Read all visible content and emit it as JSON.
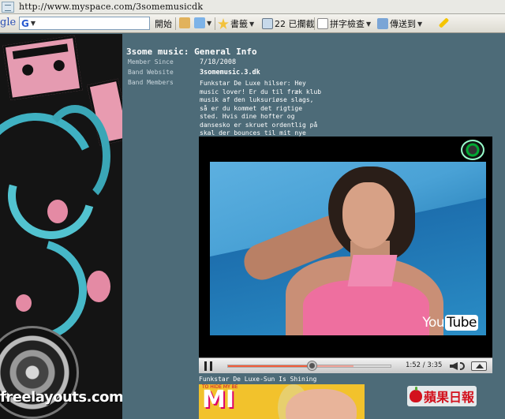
{
  "address_bar": {
    "url": "http://www.myspace.com/3somemusicdk"
  },
  "toolbar": {
    "brand": "gle",
    "search_glyph": "G",
    "open_label": "開始",
    "bookmarks_label": "書籤",
    "blocked_label": "22 已攔截",
    "spellcheck_label": "拼字檢查",
    "sendto_label": "傳送到",
    "colors": {
      "pencil": "#f5c400"
    }
  },
  "background": {
    "site_credit": "freelayouts.com"
  },
  "profile": {
    "title": "3some music: General Info",
    "fields": [
      {
        "label": "Member Since",
        "value": "7/18/2008"
      },
      {
        "label": "Band Website",
        "value": "3somemusic.3.dk"
      },
      {
        "label": "Band Members",
        "value": "Funkstar De Luxe hilser: Hey music lover! Er du til fræk klub musik af den luksuriøse slags, så er du kommet det rigtige sted. Hvis dine hofter og dansesko er skruet ordentlig på skal der bounces til mit nye track. Enjoy!"
      }
    ]
  },
  "player": {
    "brand": "YouTube",
    "brand_part1": "You",
    "brand_part2": "Tube",
    "elapsed": "1:52",
    "duration": "3:35",
    "time_display": "1:52 / 3:35",
    "buffered_fraction": 0.77,
    "played_fraction": 0.52,
    "controls": [
      "pause-icon",
      "volume-icon",
      "fullscreen-icon"
    ]
  },
  "video_caption": "Funkstar De Luxe-Sun Is Shining",
  "thumbnail": {
    "big_text": "MI",
    "small_text": "TO HIDE MY BE"
  },
  "watermark": {
    "text": "蘋果日報",
    "icon": "apple-icon",
    "color": "#d3111d"
  }
}
